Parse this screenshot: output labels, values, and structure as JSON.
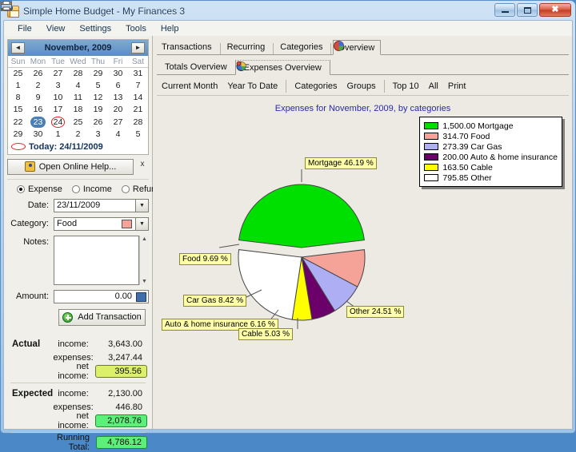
{
  "window": {
    "title": "Simple Home Budget - My Finances 3",
    "icon": "house-icon",
    "minimize": "minimize-icon",
    "maximize": "maximize-icon",
    "close": "close-icon"
  },
  "menu": [
    "File",
    "View",
    "Settings",
    "Tools",
    "Help"
  ],
  "calendar": {
    "prev": "◄",
    "next": "►",
    "title": "November, 2009",
    "weekdays": [
      "Sun",
      "Mon",
      "Tue",
      "Wed",
      "Thu",
      "Fri",
      "Sat"
    ],
    "weeks": [
      [
        {
          "d": "25",
          "s": "dim"
        },
        {
          "d": "26",
          "s": "dim"
        },
        {
          "d": "27",
          "s": "dim"
        },
        {
          "d": "28",
          "s": "dim"
        },
        {
          "d": "29",
          "s": "dim"
        },
        {
          "d": "30",
          "s": "dim"
        },
        {
          "d": "31",
          "s": "dim"
        }
      ],
      [
        {
          "d": "1",
          "s": ""
        },
        {
          "d": "2",
          "s": ""
        },
        {
          "d": "3",
          "s": ""
        },
        {
          "d": "4",
          "s": ""
        },
        {
          "d": "5",
          "s": ""
        },
        {
          "d": "6",
          "s": ""
        },
        {
          "d": "7",
          "s": ""
        }
      ],
      [
        {
          "d": "8",
          "s": ""
        },
        {
          "d": "9",
          "s": ""
        },
        {
          "d": "10",
          "s": ""
        },
        {
          "d": "11",
          "s": ""
        },
        {
          "d": "12",
          "s": ""
        },
        {
          "d": "13",
          "s": ""
        },
        {
          "d": "14",
          "s": ""
        }
      ],
      [
        {
          "d": "15",
          "s": ""
        },
        {
          "d": "16",
          "s": ""
        },
        {
          "d": "17",
          "s": ""
        },
        {
          "d": "18",
          "s": ""
        },
        {
          "d": "19",
          "s": ""
        },
        {
          "d": "20",
          "s": ""
        },
        {
          "d": "21",
          "s": ""
        }
      ],
      [
        {
          "d": "22",
          "s": ""
        },
        {
          "d": "23",
          "s": "sel"
        },
        {
          "d": "24",
          "s": "today"
        },
        {
          "d": "25",
          "s": ""
        },
        {
          "d": "26",
          "s": ""
        },
        {
          "d": "27",
          "s": ""
        },
        {
          "d": "28",
          "s": ""
        }
      ],
      [
        {
          "d": "29",
          "s": ""
        },
        {
          "d": "30",
          "s": ""
        },
        {
          "d": "1",
          "s": "dim"
        },
        {
          "d": "2",
          "s": "dim"
        },
        {
          "d": "3",
          "s": "dim"
        },
        {
          "d": "4",
          "s": "dim"
        },
        {
          "d": "5",
          "s": "dim"
        }
      ]
    ],
    "today_label": "Today: 24/11/2009"
  },
  "help": {
    "button": "Open Online Help...",
    "close": "x"
  },
  "form": {
    "types": [
      {
        "label": "Expense",
        "selected": true
      },
      {
        "label": "Income",
        "selected": false
      },
      {
        "label": "Refund",
        "selected": false
      }
    ],
    "date_label": "Date:",
    "date_value": "23/11/2009",
    "category_label": "Category:",
    "category_value": "Food",
    "category_color": "#f5a399",
    "notes_label": "Notes:",
    "notes_value": "",
    "amount_label": "Amount:",
    "amount_value": "0.00",
    "add_button": "Add Transaction"
  },
  "summary": {
    "actual": {
      "name": "Actual",
      "rows": [
        {
          "label": "income:",
          "value": "3,643.00",
          "boxed": false
        },
        {
          "label": "expenses:",
          "value": "3,247.44",
          "boxed": false
        },
        {
          "label": "net income:",
          "value": "395.56",
          "boxed": true,
          "color": "#ddf06a"
        }
      ]
    },
    "expected": {
      "name": "Expected",
      "rows": [
        {
          "label": "income:",
          "value": "2,130.00",
          "boxed": false
        },
        {
          "label": "expenses:",
          "value": "446.80",
          "boxed": false
        },
        {
          "label": "net income:",
          "value": "2,078.76",
          "boxed": true,
          "color": "#5cf07a"
        }
      ]
    },
    "running": {
      "label": "Running Total:",
      "value": "4,786.12",
      "color": "#5cf07a"
    }
  },
  "tabs_main": [
    {
      "label": "Transactions",
      "icon": "grid-icon",
      "active": false
    },
    {
      "label": "Recurring",
      "icon": "calendar-icon",
      "active": false
    },
    {
      "label": "Categories",
      "icon": "bars-icon",
      "active": false
    },
    {
      "label": "Overview",
      "icon": "pie-icon",
      "active": true
    }
  ],
  "tabs_sub": [
    {
      "label": "Totals Overview",
      "icon": "chart-icon",
      "active": false
    },
    {
      "label": "Expenses Overview",
      "icon": "pie-color-icon",
      "active": true
    }
  ],
  "toolbar": [
    {
      "label": "Current Month",
      "icon": "calendar-red-icon"
    },
    {
      "label": "Year To Date",
      "icon": "calendar-green-icon"
    },
    {
      "label": "Categories",
      "icon": "car-blue-icon"
    },
    {
      "label": "Groups",
      "icon": "cars-blue-icon"
    },
    {
      "label": "Top 10",
      "icon": "star-icon"
    },
    {
      "label": "All",
      "icon": "drawer-icon"
    },
    {
      "label": "Print",
      "icon": "printer-icon"
    }
  ],
  "chart_data": {
    "type": "pie",
    "title": "Expenses for November, 2009, by categories",
    "total": 3247.44,
    "legend_position": "top-right",
    "exploded_slice": "Mortgage",
    "categories": [
      "Mortgage",
      "Food",
      "Car Gas",
      "Auto & home insurance",
      "Cable",
      "Other"
    ],
    "values": [
      1500.0,
      314.7,
      273.39,
      200.0,
      163.5,
      795.85
    ],
    "percents": [
      46.19,
      9.69,
      8.42,
      6.16,
      5.03,
      24.51
    ],
    "colors": [
      "#00e000",
      "#f5a399",
      "#aeaef5",
      "#6b006b",
      "#ffff00",
      "#ffffff"
    ],
    "legend_labels": [
      "1,500.00 Mortgage",
      "314.70 Food",
      "273.39 Car Gas",
      "200.00 Auto & home insurance",
      "163.50 Cable",
      "795.85 Other"
    ],
    "callouts": [
      "Mortgage 46.19 %",
      "Food 9.69 %",
      "Car Gas 8.42 %",
      "Auto & home insurance 6.16 %",
      "Cable 5.03 %",
      "Other 24.51 %"
    ]
  }
}
